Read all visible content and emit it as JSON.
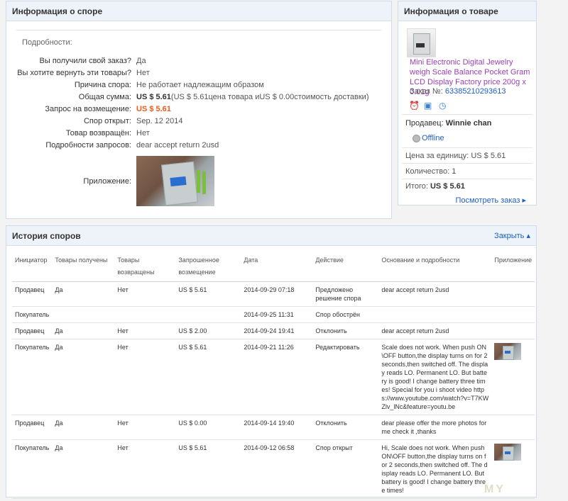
{
  "dispute": {
    "title": "Информация о споре",
    "subtitle": "Подробности:",
    "rows": [
      {
        "label": "Вы получили свой заказ?",
        "value": "Да"
      },
      {
        "label": "Вы хотите вернуть эти товары?",
        "value": "Нет"
      },
      {
        "label": "Причина спора:",
        "value": "Не работает надлежащим образом"
      },
      {
        "label": "Общая сумма:",
        "value_bold": "US $ 5.61",
        "value": "(US $ 5.61цена товара иUS $ 0.00стоимость доставки)"
      },
      {
        "label": "Запрос на возмещение:",
        "value": "US $ 5.61"
      },
      {
        "label": "Спор открыт:",
        "value": "Sep. 12 2014"
      },
      {
        "label": "Товар возвращён:",
        "value": "Нет"
      },
      {
        "label": "Подробности запросов:",
        "value": "dear accept return 2usd"
      }
    ],
    "attachment_label": "Приложение:",
    "refund_color": "#f05a1a"
  },
  "product": {
    "title": "Информация о товаре",
    "name": "Mini Electronic Digital Jewelry weigh Scale Balance Pocket Gram LCD Display Factory price 200g x 0.01g",
    "order_label": "Заказ №:",
    "order_number": "63385210293613",
    "icons": [
      "alarm-icon",
      "image-icon",
      "clock-icon"
    ],
    "seller_label": "Продавец:",
    "seller_name": "Winnie chan",
    "status": "Offline",
    "unit_price_label": "Цена за единицу:",
    "unit_price": "US $ 5.61",
    "qty_label": "Количество:",
    "qty": "1",
    "total_label": "Итого:",
    "total": "US $ 5.61",
    "view_order": "Посмотреть заказ ▸"
  },
  "history": {
    "title": "История споров",
    "collapse": "Закрыть ▴",
    "columns": [
      "Инициатор",
      "Товары получены",
      "Товары возвращены",
      "Запрошенное возмещение",
      "Дата",
      "Действие",
      "Основание и подробности",
      "Приложение"
    ],
    "rows": [
      {
        "initiator": "Продавец",
        "received": "Да",
        "returned": "Нет",
        "refund": "US $ 5.61",
        "date": "2014-09-29 07:18",
        "action": "Предложено решение спора",
        "reason": "dear accept return 2usd",
        "has_attachment": false
      },
      {
        "initiator": "Покупатель",
        "received": "",
        "returned": "",
        "refund": "",
        "date": "2014-09-25 11:31",
        "action": "Спор обострён",
        "reason": "",
        "has_attachment": false
      },
      {
        "initiator": "Продавец",
        "received": "Да",
        "returned": "Нет",
        "refund": "US $ 2.00",
        "date": "2014-09-24 19:41",
        "action": "Отклонить",
        "reason": "dear accept return 2usd",
        "has_attachment": false
      },
      {
        "initiator": "Покупатель",
        "received": "Да",
        "returned": "Нет",
        "refund": "US $ 5.61",
        "date": "2014-09-21 11:26",
        "action": "Редактировать",
        "reason": "Scale does not work. When push ON\\OFF button,the display turns on for 2 seconds,then switched off. The display reads LO. Permanent LO. But battery is good! I change battery three times! Special for you i shoot video https://www.youtube.com/watch?v=T7KWZlv_lNc&feature=youtu.be",
        "has_attachment": true
      },
      {
        "initiator": "Продавец",
        "received": "Да",
        "returned": "Нет",
        "refund": "US $ 0.00",
        "date": "2014-09-14 19:40",
        "action": "Отклонить",
        "reason": "dear please offer the more photos for me check it ,thanks",
        "has_attachment": false
      },
      {
        "initiator": "Покупатель",
        "received": "Да",
        "returned": "Нет",
        "refund": "US $ 5.61",
        "date": "2014-09-12 06:58",
        "action": "Спор открыт",
        "reason": "Hi, Scale does not work. When push ON\\OFF button,the display turns on for 2 seconds,then switched off. The display reads LO. Permanent LO. But battery is good! I change battery three times!",
        "has_attachment": true
      }
    ]
  },
  "watermark": "MY"
}
